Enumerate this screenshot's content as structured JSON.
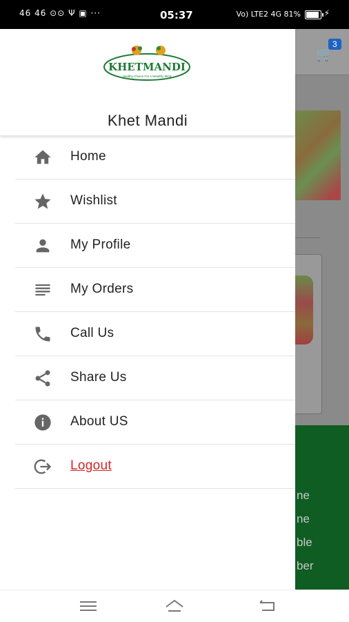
{
  "status_bar": {
    "left_indicators": "46 46 ⊙⊙ Ψ ▣ ···",
    "time": "05:37",
    "network": "Vo) LTE2 4G",
    "battery": "81%",
    "battery_level": 0.81
  },
  "background_app": {
    "cart_badge": "3",
    "green_lines": [
      "ne",
      "ne",
      "ble",
      "ber"
    ]
  },
  "drawer": {
    "logo_text": "KHETMANDI",
    "logo_tagline": "Healthy Choice For A Wealthy Mind",
    "app_name": "Khet Mandi",
    "items": [
      {
        "label": "Home",
        "icon": "home-icon"
      },
      {
        "label": "Wishlist",
        "icon": "star-icon"
      },
      {
        "label": "My Profile",
        "icon": "person-icon"
      },
      {
        "label": "My Orders",
        "icon": "list-icon"
      },
      {
        "label": "Call Us",
        "icon": "phone-icon"
      },
      {
        "label": "Share Us",
        "icon": "share-icon"
      },
      {
        "label": "About US",
        "icon": "info-icon"
      },
      {
        "label": "Logout",
        "icon": "logout-icon"
      }
    ]
  },
  "colors": {
    "brand_green": "#1c7a34",
    "logout_red": "#d32424",
    "icon_gray": "#666666",
    "cart_badge_blue": "#1e63c4"
  }
}
